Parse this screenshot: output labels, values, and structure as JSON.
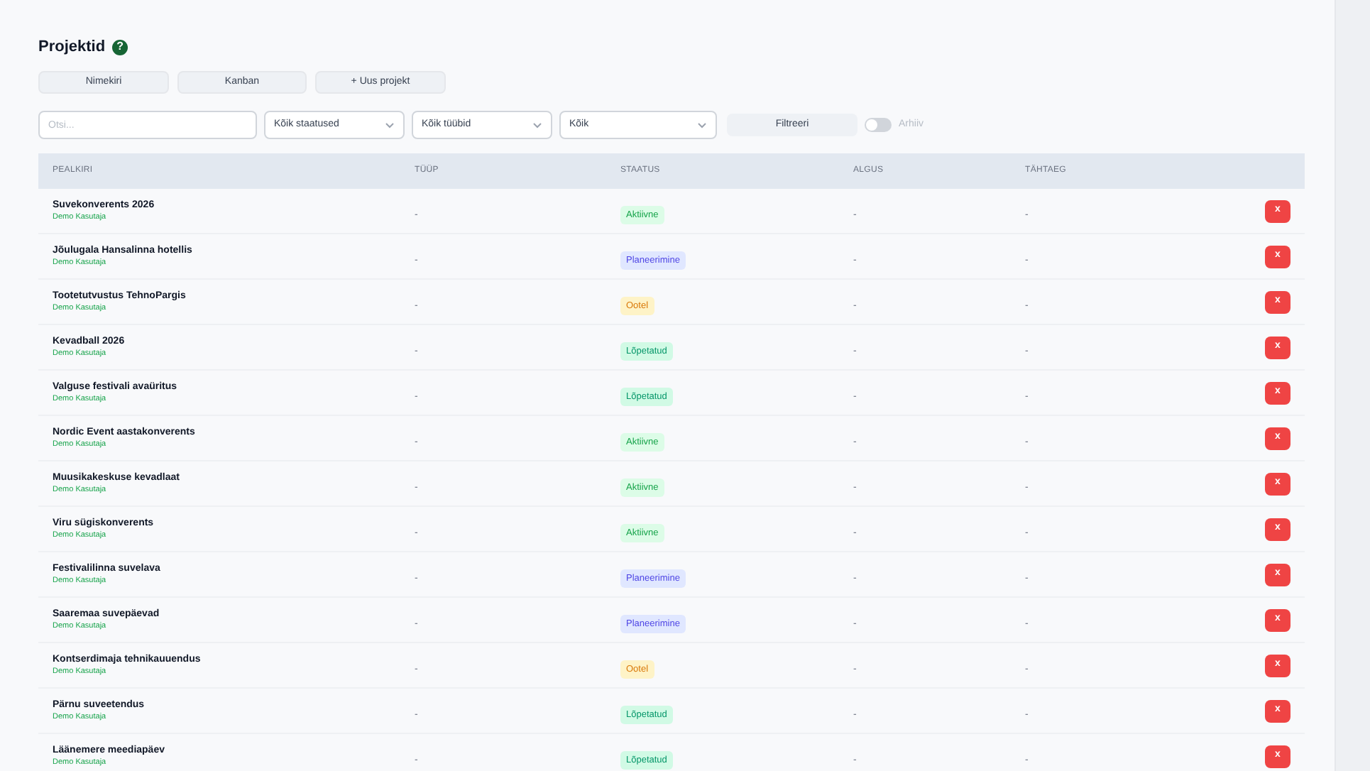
{
  "page": {
    "title": "Projektid",
    "help": "?"
  },
  "view_buttons": [
    {
      "label": "Nimekiri"
    },
    {
      "label": "Kanban"
    },
    {
      "label": "+ Uus projekt"
    }
  ],
  "filters": {
    "search": {
      "placeholder": "Otsi..."
    },
    "selects": [
      {
        "value": "Kõik staatused"
      },
      {
        "value": "Kõik tüübid"
      },
      {
        "value": "Kõik"
      }
    ],
    "filter_button": "Filtreeri",
    "archive_toggle": {
      "label": "Arhiiv",
      "on": false
    }
  },
  "table": {
    "columns": [
      "PEALKIRI",
      "TÜÜP",
      "STAATUS",
      "ALGUS",
      "TÄHTAEG"
    ],
    "rows": [
      {
        "title": "Suvekonverents 2026",
        "owner": "Demo Kasutaja",
        "type": "-",
        "status": {
          "label": "Aktiivne",
          "kind": "active"
        },
        "start": "-",
        "deadline": "-",
        "delete": "x"
      },
      {
        "title": "Jõulugala Hansalinna hotellis",
        "owner": "Demo Kasutaja",
        "type": "-",
        "status": {
          "label": "Planeerimine",
          "kind": "planning"
        },
        "start": "-",
        "deadline": "-",
        "delete": "x"
      },
      {
        "title": "Tootetutvustus TehnoPargis",
        "owner": "Demo Kasutaja",
        "type": "-",
        "status": {
          "label": "Ootel",
          "kind": "waiting"
        },
        "start": "-",
        "deadline": "-",
        "delete": "x"
      },
      {
        "title": "Kevadball 2026",
        "owner": "Demo Kasutaja",
        "type": "-",
        "status": {
          "label": "Lõpetatud",
          "kind": "done"
        },
        "start": "-",
        "deadline": "-",
        "delete": "x"
      },
      {
        "title": "Valguse festivali avaüritus",
        "owner": "Demo Kasutaja",
        "type": "-",
        "status": {
          "label": "Lõpetatud",
          "kind": "done"
        },
        "start": "-",
        "deadline": "-",
        "delete": "x"
      },
      {
        "title": "Nordic Event aastakonverents",
        "owner": "Demo Kasutaja",
        "type": "-",
        "status": {
          "label": "Aktiivne",
          "kind": "active"
        },
        "start": "-",
        "deadline": "-",
        "delete": "x"
      },
      {
        "title": "Muusikakeskuse kevadlaat",
        "owner": "Demo Kasutaja",
        "type": "-",
        "status": {
          "label": "Aktiivne",
          "kind": "active"
        },
        "start": "-",
        "deadline": "-",
        "delete": "x"
      },
      {
        "title": "Viru sügiskonverents",
        "owner": "Demo Kasutaja",
        "type": "-",
        "status": {
          "label": "Aktiivne",
          "kind": "active"
        },
        "start": "-",
        "deadline": "-",
        "delete": "x"
      },
      {
        "title": "Festivalilinna suvelava",
        "owner": "Demo Kasutaja",
        "type": "-",
        "status": {
          "label": "Planeerimine",
          "kind": "planning"
        },
        "start": "-",
        "deadline": "-",
        "delete": "x"
      },
      {
        "title": "Saaremaa suvepäevad",
        "owner": "Demo Kasutaja",
        "type": "-",
        "status": {
          "label": "Planeerimine",
          "kind": "planning"
        },
        "start": "-",
        "deadline": "-",
        "delete": "x"
      },
      {
        "title": "Kontserdimaja tehnikauuendus",
        "owner": "Demo Kasutaja",
        "type": "-",
        "status": {
          "label": "Ootel",
          "kind": "waiting"
        },
        "start": "-",
        "deadline": "-",
        "delete": "x"
      },
      {
        "title": "Pärnu suveetendus",
        "owner": "Demo Kasutaja",
        "type": "-",
        "status": {
          "label": "Lõpetatud",
          "kind": "done"
        },
        "start": "-",
        "deadline": "-",
        "delete": "x"
      },
      {
        "title": "Läänemere meediapäev",
        "owner": "Demo Kasutaja",
        "type": "-",
        "status": {
          "label": "Lõpetatud",
          "kind": "done"
        },
        "start": "-",
        "deadline": "-",
        "delete": "x"
      }
    ]
  }
}
